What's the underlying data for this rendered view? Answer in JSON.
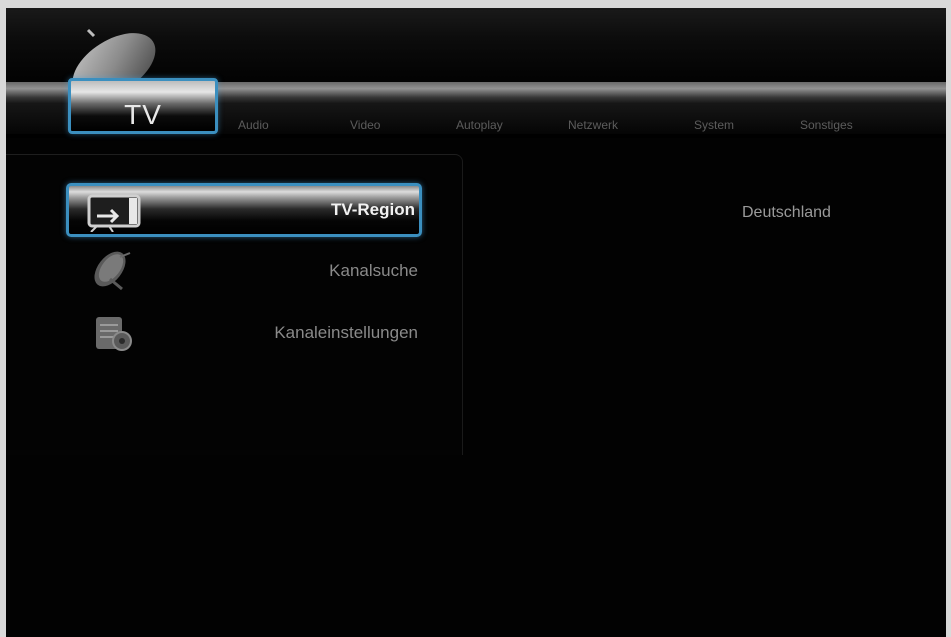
{
  "header": {
    "active_tab": "TV",
    "tabs": [
      "Audio",
      "Video",
      "Autoplay",
      "Netzwerk",
      "System",
      "Sonstiges"
    ]
  },
  "menu": {
    "items": [
      {
        "label": "TV-Region",
        "icon": "tv-region-icon",
        "selected": true
      },
      {
        "label": "Kanalsuche",
        "icon": "satellite-dish-icon",
        "selected": false
      },
      {
        "label": "Kanaleinstellungen",
        "icon": "channel-settings-icon",
        "selected": false
      }
    ]
  },
  "detail": {
    "value": "Deutschland"
  },
  "colors": {
    "accent": "#3b8fbf",
    "background": "#020202",
    "text_selected": "#f2f2f2",
    "text_dim": "#8a8a8a"
  }
}
